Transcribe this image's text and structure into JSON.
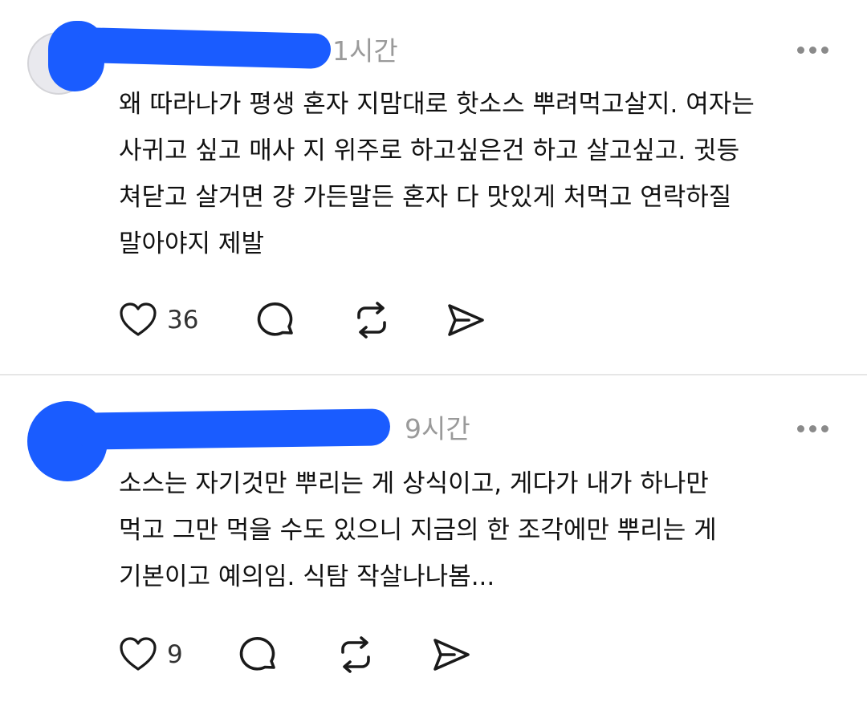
{
  "comments": [
    {
      "time": "1시간",
      "text": "왜 따라나가 평생 혼자 지맘대로 핫소스 뿌려먹고살지. 여자는\n사귀고 싶고 매사 지 위주로 하고싶은건 하고 살고싶고. 귓등\n쳐닫고 살거면 걍 가든말든 혼자 다 맛있게 처먹고 연락하질\n말아야지 제발",
      "likes": "36",
      "icons": [
        "heart-icon",
        "comment-icon",
        "repost-icon",
        "share-icon",
        "more-icon"
      ]
    },
    {
      "time": "9시간",
      "text": "소스는 자기것만 뿌리는 게 상식이고, 게다가 내가 하나만\n먹고 그만 먹을 수도 있으니 지금의 한 조각에만 뿌리는 게\n기본이고 예의임. 식탐 작살나나봄...",
      "likes": "9",
      "icons": [
        "heart-icon",
        "comment-icon",
        "repost-icon",
        "share-icon",
        "more-icon"
      ]
    }
  ],
  "colors": {
    "redaction": "#1a5cff",
    "divider": "#e6e6e6",
    "muted_text": "#9a9a9a"
  }
}
